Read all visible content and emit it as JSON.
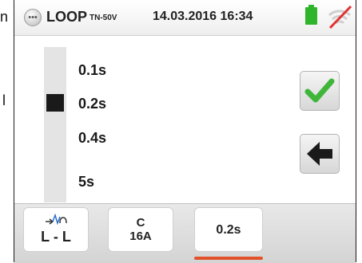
{
  "page_edge": {
    "top_glyph": "n",
    "mid_glyph": "l"
  },
  "header": {
    "title": "LOOP",
    "title_subscript": "TN-50V",
    "datetime": "14.03.2016 16:34",
    "battery_color": "#2fb52c",
    "signal_icon": "no-wifi-icon"
  },
  "time_selector": {
    "options": [
      "0.1s",
      "0.2s",
      "0.4s",
      "5s"
    ],
    "selected": "0.2s",
    "selected_index": 1
  },
  "actions": {
    "confirm_icon": "check-icon",
    "back_icon": "arrow-left-icon"
  },
  "bottom_tabs": [
    {
      "icon": "loop-measure-icon",
      "label": "L - L"
    },
    {
      "label_top": "C",
      "label_bottom": "16A"
    },
    {
      "label": "0.2s",
      "active": true
    }
  ],
  "colors": {
    "accent_underline": "#e1522a",
    "check_green": "#3fb63a"
  }
}
